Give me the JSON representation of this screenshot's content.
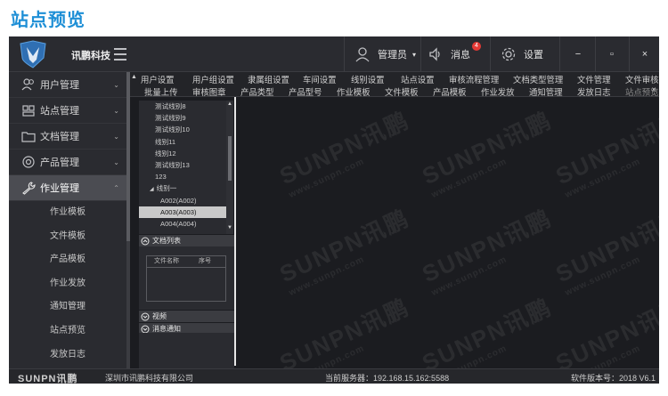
{
  "page_title": "站点预览",
  "header": {
    "brand": "讯鹏科技",
    "user_label": "管理员",
    "message_label": "消息",
    "message_count": "4",
    "settings_label": "设置",
    "minimize_label": "−",
    "maximize_label": "▫",
    "close_label": "×",
    "icons": {
      "logo": "brand-shield-icon",
      "menu": "hamburger-icon",
      "user": "user-icon",
      "message": "speaker-icon",
      "settings": "gear-icon"
    }
  },
  "sidebar": {
    "menus": [
      {
        "label": "用户管理",
        "icon": "users-icon"
      },
      {
        "label": "站点管理",
        "icon": "site-icon"
      },
      {
        "label": "文档管理",
        "icon": "folder-icon"
      },
      {
        "label": "产品管理",
        "icon": "product-icon"
      },
      {
        "label": "作业管理",
        "icon": "wrench-icon"
      }
    ],
    "submenu": [
      "作业模板",
      "文件模板",
      "产品模板",
      "作业发放",
      "通知管理",
      "站点预览",
      "发放日志"
    ]
  },
  "tabs_row1": [
    "用户设置",
    "用户组设置",
    "隶属组设置",
    "车间设置",
    "线别设置",
    "站点设置",
    "审核流程管理",
    "文档类型管理",
    "文件管理",
    "文件审核"
  ],
  "tabs_row2": [
    "批量上传",
    "审核图章",
    "产品类型",
    "产品型号",
    "作业模板",
    "文件模板",
    "产品模板",
    "作业发放",
    "通知管理",
    "发放日志",
    "站点预览"
  ],
  "tree": {
    "nodes": [
      "测试线别8",
      "测试线别9",
      "测试线别10",
      "线别11",
      "线别12",
      "测试线别13",
      "123",
      "线别一",
      "A002(A002)",
      "A003(A003)",
      "A004(A004)"
    ],
    "selected": "A003(A003)"
  },
  "panels": {
    "doc_list": "文档列表",
    "doc_columns": [
      "文件名称",
      "序号"
    ],
    "video": "视频",
    "message_notice": "消息通知"
  },
  "watermark": {
    "brand": "SUNPN讯鹏",
    "url": "www.sunpn.com"
  },
  "footer": {
    "logo": "SUNPN讯鹏",
    "company": "深圳市讯鹏科技有限公司",
    "server": "当前服务器：192.168.15.162:5588",
    "version": "软件版本号：2018 V6.1"
  }
}
